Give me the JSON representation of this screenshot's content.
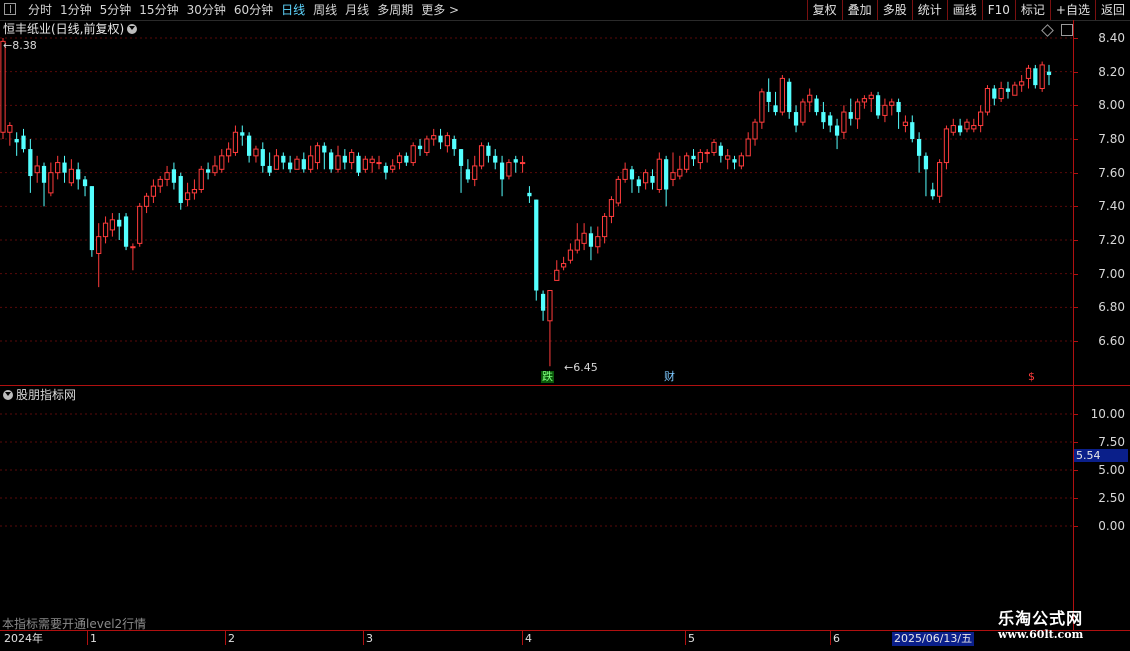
{
  "toolbar": {
    "period_tabs": [
      "分时",
      "1分钟",
      "5分钟",
      "15分钟",
      "30分钟",
      "60分钟",
      "日线",
      "周线",
      "月线",
      "多周期",
      "更多 >"
    ],
    "active_tab": "日线",
    "right_tools": [
      "复权",
      "叠加",
      "多股",
      "统计",
      "画线",
      "F10",
      "标记",
      "+自选",
      "返回"
    ]
  },
  "main": {
    "title": "恒丰纸业(日线,前复权)",
    "high_label": "8.38",
    "low_label": "6.45",
    "markers": {
      "drop": "跌",
      "finance": "财",
      "dollar": "$"
    },
    "y_labels": [
      "8.40",
      "8.20",
      "8.00",
      "7.80",
      "7.60",
      "7.40",
      "7.20",
      "7.00",
      "6.80",
      "6.60"
    ]
  },
  "sub": {
    "title": "股朋指标网",
    "y_labels": [
      "10.00",
      "7.50",
      "5.00",
      "2.50",
      "0.00"
    ],
    "value_tag": "5.54",
    "note": "本指标需要开通level2行情"
  },
  "date_axis": {
    "labels": [
      "2024年",
      "1",
      "2",
      "3",
      "4",
      "5",
      "6"
    ],
    "current": "2025/06/13/五"
  },
  "watermark": {
    "line1": "乐淘公式网",
    "line2": "www.60lt.com"
  },
  "colors": {
    "up": "#ff3c3c",
    "down": "#54ffff",
    "axis": "#b01010",
    "grid": "#5a0a0a"
  },
  "chart_data": {
    "type": "candlestick",
    "ylim": [
      6.4,
      8.45
    ],
    "candles": [
      [
        7.84,
        8.38,
        8.4,
        7.8
      ],
      [
        7.84,
        7.88,
        7.9,
        7.76
      ],
      [
        7.8,
        7.78,
        7.84,
        7.7
      ],
      [
        7.82,
        7.74,
        7.86,
        7.72
      ],
      [
        7.74,
        7.58,
        7.8,
        7.48
      ],
      [
        7.6,
        7.64,
        7.7,
        7.54
      ],
      [
        7.64,
        7.54,
        7.66,
        7.4
      ],
      [
        7.48,
        7.6,
        7.66,
        7.46
      ],
      [
        7.6,
        7.66,
        7.7,
        7.56
      ],
      [
        7.66,
        7.6,
        7.7,
        7.54
      ],
      [
        7.54,
        7.62,
        7.68,
        7.52
      ],
      [
        7.62,
        7.56,
        7.66,
        7.5
      ],
      [
        7.56,
        7.52,
        7.58,
        7.46
      ],
      [
        7.52,
        7.14,
        7.52,
        7.1
      ],
      [
        7.12,
        7.22,
        7.3,
        6.92
      ],
      [
        7.22,
        7.3,
        7.34,
        7.18
      ],
      [
        7.26,
        7.32,
        7.36,
        7.22
      ],
      [
        7.32,
        7.28,
        7.36,
        7.2
      ],
      [
        7.34,
        7.16,
        7.36,
        7.14
      ],
      [
        7.16,
        7.16,
        7.18,
        7.02
      ],
      [
        7.18,
        7.4,
        7.42,
        7.16
      ],
      [
        7.4,
        7.46,
        7.48,
        7.36
      ],
      [
        7.46,
        7.52,
        7.56,
        7.42
      ],
      [
        7.52,
        7.56,
        7.58,
        7.48
      ],
      [
        7.56,
        7.6,
        7.64,
        7.52
      ],
      [
        7.62,
        7.54,
        7.66,
        7.5
      ],
      [
        7.58,
        7.42,
        7.6,
        7.38
      ],
      [
        7.44,
        7.48,
        7.54,
        7.4
      ],
      [
        7.48,
        7.5,
        7.56,
        7.44
      ],
      [
        7.5,
        7.62,
        7.64,
        7.48
      ],
      [
        7.62,
        7.6,
        7.66,
        7.56
      ],
      [
        7.6,
        7.64,
        7.7,
        7.58
      ],
      [
        7.62,
        7.7,
        7.74,
        7.6
      ],
      [
        7.7,
        7.74,
        7.78,
        7.66
      ],
      [
        7.72,
        7.84,
        7.88,
        7.7
      ],
      [
        7.84,
        7.82,
        7.88,
        7.76
      ],
      [
        7.82,
        7.7,
        7.84,
        7.66
      ],
      [
        7.7,
        7.74,
        7.76,
        7.66
      ],
      [
        7.74,
        7.64,
        7.78,
        7.6
      ],
      [
        7.64,
        7.6,
        7.72,
        7.58
      ],
      [
        7.62,
        7.7,
        7.74,
        7.62
      ],
      [
        7.7,
        7.66,
        7.72,
        7.62
      ],
      [
        7.66,
        7.62,
        7.7,
        7.6
      ],
      [
        7.62,
        7.68,
        7.7,
        7.62
      ],
      [
        7.68,
        7.62,
        7.72,
        7.6
      ],
      [
        7.62,
        7.7,
        7.76,
        7.6
      ],
      [
        7.66,
        7.76,
        7.78,
        7.62
      ],
      [
        7.76,
        7.72,
        7.78,
        7.62
      ],
      [
        7.72,
        7.62,
        7.74,
        7.6
      ],
      [
        7.62,
        7.7,
        7.76,
        7.6
      ],
      [
        7.7,
        7.66,
        7.74,
        7.62
      ],
      [
        7.66,
        7.72,
        7.74,
        7.62
      ],
      [
        7.7,
        7.6,
        7.72,
        7.58
      ],
      [
        7.62,
        7.68,
        7.7,
        7.6
      ],
      [
        7.66,
        7.68,
        7.7,
        7.6
      ],
      [
        7.66,
        7.66,
        7.7,
        7.62
      ],
      [
        7.64,
        7.6,
        7.66,
        7.56
      ],
      [
        7.62,
        7.64,
        7.68,
        7.6
      ],
      [
        7.66,
        7.7,
        7.72,
        7.62
      ],
      [
        7.7,
        7.66,
        7.72,
        7.64
      ],
      [
        7.66,
        7.76,
        7.78,
        7.64
      ],
      [
        7.76,
        7.74,
        7.8,
        7.7
      ],
      [
        7.72,
        7.8,
        7.82,
        7.7
      ],
      [
        7.8,
        7.82,
        7.86,
        7.76
      ],
      [
        7.82,
        7.78,
        7.86,
        7.74
      ],
      [
        7.76,
        7.82,
        7.84,
        7.72
      ],
      [
        7.8,
        7.74,
        7.82,
        7.7
      ],
      [
        7.74,
        7.64,
        7.74,
        7.48
      ],
      [
        7.62,
        7.56,
        7.68,
        7.54
      ],
      [
        7.56,
        7.64,
        7.7,
        7.52
      ],
      [
        7.64,
        7.76,
        7.78,
        7.62
      ],
      [
        7.76,
        7.7,
        7.78,
        7.66
      ],
      [
        7.7,
        7.66,
        7.74,
        7.62
      ],
      [
        7.66,
        7.56,
        7.7,
        7.46
      ],
      [
        7.58,
        7.66,
        7.68,
        7.56
      ],
      [
        7.68,
        7.66,
        7.7,
        7.6
      ],
      [
        7.66,
        7.66,
        7.7,
        7.6
      ],
      [
        7.48,
        7.46,
        7.52,
        7.42
      ],
      [
        7.44,
        6.9,
        7.44,
        6.84
      ],
      [
        6.88,
        6.78,
        6.9,
        6.72
      ],
      [
        6.72,
        6.9,
        6.9,
        6.45
      ],
      [
        6.96,
        7.02,
        7.08,
        6.96
      ],
      [
        7.04,
        7.06,
        7.1,
        7.02
      ],
      [
        7.08,
        7.14,
        7.18,
        7.06
      ],
      [
        7.14,
        7.2,
        7.3,
        7.12
      ],
      [
        7.18,
        7.24,
        7.3,
        7.14
      ],
      [
        7.24,
        7.16,
        7.28,
        7.08
      ],
      [
        7.16,
        7.22,
        7.28,
        7.12
      ],
      [
        7.22,
        7.34,
        7.36,
        7.18
      ],
      [
        7.34,
        7.44,
        7.46,
        7.3
      ],
      [
        7.42,
        7.56,
        7.58,
        7.4
      ],
      [
        7.56,
        7.62,
        7.66,
        7.54
      ],
      [
        7.62,
        7.56,
        7.64,
        7.48
      ],
      [
        7.56,
        7.52,
        7.58,
        7.48
      ],
      [
        7.54,
        7.6,
        7.62,
        7.5
      ],
      [
        7.58,
        7.54,
        7.62,
        7.5
      ],
      [
        7.5,
        7.68,
        7.72,
        7.48
      ],
      [
        7.68,
        7.5,
        7.7,
        7.4
      ],
      [
        7.56,
        7.6,
        7.72,
        7.52
      ],
      [
        7.58,
        7.62,
        7.7,
        7.56
      ],
      [
        7.62,
        7.7,
        7.72,
        7.6
      ],
      [
        7.7,
        7.68,
        7.74,
        7.64
      ],
      [
        7.66,
        7.72,
        7.74,
        7.62
      ],
      [
        7.72,
        7.72,
        7.74,
        7.66
      ],
      [
        7.72,
        7.78,
        7.8,
        7.7
      ],
      [
        7.76,
        7.7,
        7.78,
        7.66
      ],
      [
        7.68,
        7.7,
        7.74,
        7.62
      ],
      [
        7.68,
        7.66,
        7.7,
        7.62
      ],
      [
        7.64,
        7.7,
        7.72,
        7.62
      ],
      [
        7.7,
        7.8,
        7.84,
        7.7
      ],
      [
        7.8,
        7.9,
        7.92,
        7.76
      ],
      [
        7.9,
        8.08,
        8.1,
        7.86
      ],
      [
        8.08,
        8.02,
        8.16,
        7.96
      ],
      [
        8.0,
        7.96,
        8.08,
        7.94
      ],
      [
        7.96,
        8.16,
        8.18,
        7.94
      ],
      [
        8.14,
        7.96,
        8.16,
        7.92
      ],
      [
        7.96,
        7.88,
        8.0,
        7.84
      ],
      [
        7.9,
        8.02,
        8.04,
        7.88
      ],
      [
        8.02,
        8.06,
        8.1,
        7.96
      ],
      [
        8.04,
        7.96,
        8.06,
        7.94
      ],
      [
        7.96,
        7.9,
        8.02,
        7.86
      ],
      [
        7.94,
        7.88,
        7.96,
        7.84
      ],
      [
        7.88,
        7.82,
        7.92,
        7.74
      ],
      [
        7.84,
        7.96,
        8.0,
        7.8
      ],
      [
        7.96,
        7.92,
        8.04,
        7.88
      ],
      [
        7.92,
        8.02,
        8.04,
        7.86
      ],
      [
        8.02,
        8.04,
        8.06,
        7.98
      ],
      [
        8.04,
        8.06,
        8.08,
        7.96
      ],
      [
        8.06,
        7.94,
        8.08,
        7.92
      ],
      [
        7.94,
        8.0,
        8.04,
        7.9
      ],
      [
        8.0,
        8.02,
        8.04,
        7.94
      ],
      [
        8.02,
        7.96,
        8.04,
        7.86
      ],
      [
        7.88,
        7.9,
        7.94,
        7.84
      ],
      [
        7.9,
        7.8,
        7.94,
        7.78
      ],
      [
        7.8,
        7.7,
        7.84,
        7.6
      ],
      [
        7.7,
        7.62,
        7.72,
        7.46
      ],
      [
        7.5,
        7.46,
        7.54,
        7.44
      ],
      [
        7.46,
        7.66,
        7.68,
        7.42
      ],
      [
        7.66,
        7.86,
        7.88,
        7.62
      ],
      [
        7.84,
        7.88,
        7.92,
        7.82
      ],
      [
        7.88,
        7.84,
        7.92,
        7.82
      ],
      [
        7.86,
        7.9,
        7.92,
        7.84
      ],
      [
        7.86,
        7.88,
        7.92,
        7.84
      ],
      [
        7.88,
        7.96,
        8.0,
        7.84
      ],
      [
        7.96,
        8.1,
        8.12,
        7.94
      ],
      [
        8.1,
        8.04,
        8.12,
        8.0
      ],
      [
        8.04,
        8.1,
        8.14,
        8.02
      ],
      [
        8.1,
        8.08,
        8.14,
        8.04
      ],
      [
        8.06,
        8.12,
        8.14,
        8.06
      ],
      [
        8.12,
        8.14,
        8.18,
        8.08
      ],
      [
        8.16,
        8.22,
        8.24,
        8.1
      ],
      [
        8.22,
        8.12,
        8.24,
        8.1
      ],
      [
        8.1,
        8.24,
        8.26,
        8.08
      ],
      [
        8.2,
        8.18,
        8.24,
        8.12
      ]
    ]
  }
}
